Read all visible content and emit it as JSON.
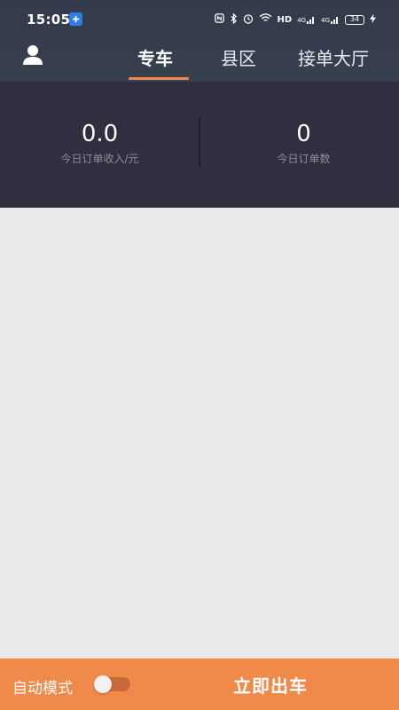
{
  "status_bar": {
    "time": "15:05",
    "network": "HD",
    "signal_1": "4G",
    "signal_2": "4G",
    "battery": "34"
  },
  "nav": {
    "tabs": [
      {
        "label": "专车",
        "active": true
      },
      {
        "label": "县区",
        "active": false
      },
      {
        "label": "接单大厅",
        "active": false
      }
    ]
  },
  "stats": {
    "income": {
      "value": "0.0",
      "label": "今日订单收入/元"
    },
    "orders": {
      "value": "0",
      "label": "今日订单数"
    }
  },
  "bottom_bar": {
    "auto_mode_label": "自动模式",
    "auto_mode_on": false,
    "depart_label": "立即出车"
  },
  "colors": {
    "header": "#353d4d",
    "stats_bg": "#2f2f3f",
    "accent": "#f08a4b",
    "content_bg": "#ebe9ea"
  },
  "icons": {
    "avatar": "user-icon",
    "status": [
      "nfc-icon",
      "bluetooth-icon",
      "alarm-icon",
      "wifi-icon",
      "signal-icon",
      "battery-icon",
      "charging-icon"
    ]
  }
}
